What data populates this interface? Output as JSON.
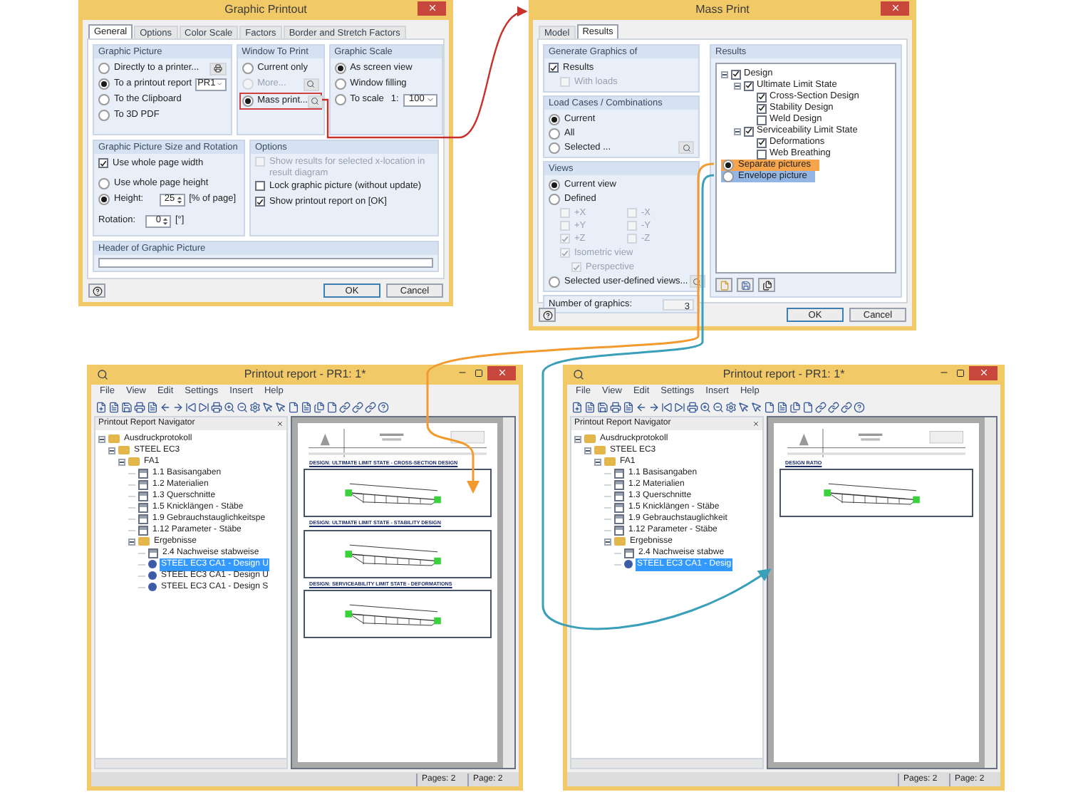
{
  "graphic_printout": {
    "title": "Graphic Printout",
    "tabs": [
      {
        "label": "General",
        "selected": true
      },
      {
        "label": "Options",
        "selected": false
      },
      {
        "label": "Color Scale",
        "selected": false
      },
      {
        "label": "Factors",
        "selected": false
      },
      {
        "label": "Border and Stretch Factors",
        "selected": false
      }
    ],
    "graphic_picture": {
      "title": "Graphic Picture",
      "options": [
        {
          "label": "Directly to a printer...",
          "selected": false
        },
        {
          "label": "To a printout report",
          "selected": true
        },
        {
          "label": "To the Clipboard",
          "selected": false
        },
        {
          "label": "To 3D PDF",
          "selected": false
        }
      ],
      "report": "PR1"
    },
    "window_to_print": {
      "title": "Window To Print",
      "options": [
        {
          "label": "Current only",
          "selected": false,
          "disabled": false,
          "highlighted": false
        },
        {
          "label": "More...",
          "selected": false,
          "disabled": true,
          "highlighted": false
        },
        {
          "label": "Mass print...",
          "selected": true,
          "disabled": false,
          "highlighted": true
        }
      ]
    },
    "graphic_scale": {
      "title": "Graphic Scale",
      "options": [
        {
          "label": "As screen view",
          "selected": true
        },
        {
          "label": "Window filling",
          "selected": false
        },
        {
          "label": "To scale",
          "selected": false
        }
      ],
      "scale_prefix": "1:",
      "scale": "100"
    },
    "size_rotation": {
      "title": "Graphic Picture Size and Rotation",
      "whole_width": {
        "label": "Use whole page width",
        "checked": true
      },
      "size_options": [
        {
          "label": "Use whole page height",
          "selected": false
        },
        {
          "label": "Height:",
          "selected": true
        }
      ],
      "height": {
        "value": "25",
        "unit": "[% of page]"
      },
      "rotation": {
        "label": "Rotation:",
        "value": "0",
        "unit": "[°]"
      }
    },
    "options": {
      "title": "Options",
      "items": [
        {
          "label": "Show results for selected x-location in result diagram",
          "checked": false,
          "disabled": true
        },
        {
          "label": "Lock graphic picture (without update)",
          "checked": false,
          "disabled": false
        },
        {
          "label": "Show printout report on [OK]",
          "checked": true,
          "disabled": false
        }
      ]
    },
    "header": {
      "title": "Header of Graphic Picture"
    },
    "buttons": [
      "OK",
      "Cancel"
    ]
  },
  "mass_print": {
    "title": "Mass Print",
    "tabs": [
      {
        "label": "Model",
        "selected": false
      },
      {
        "label": "Results",
        "selected": true
      }
    ],
    "generate": {
      "title": "Generate Graphics of",
      "items": [
        {
          "label": "Results",
          "checked": true,
          "disabled": false
        },
        {
          "label": "With loads",
          "checked": false,
          "disabled": true
        }
      ]
    },
    "load_cases": {
      "title": "Load Cases / Combinations",
      "options": [
        {
          "label": "Current",
          "selected": true
        },
        {
          "label": "All",
          "selected": false
        },
        {
          "label": "Selected ...",
          "selected": false
        }
      ]
    },
    "views": {
      "title": "Views",
      "options": [
        {
          "label": "Current view",
          "selected": true
        },
        {
          "label": "Defined",
          "selected": false
        }
      ],
      "directions": [
        {
          "label": "+X",
          "checked": false
        },
        {
          "label": "-X",
          "checked": false
        },
        {
          "label": "+Y",
          "checked": false
        },
        {
          "label": "-Y",
          "checked": false
        },
        {
          "label": "+Z",
          "checked": true
        },
        {
          "label": "-Z",
          "checked": false
        }
      ],
      "isometric": {
        "label": "Isometric view",
        "checked": true
      },
      "perspective": {
        "label": "Perspective",
        "checked": true
      },
      "user_defined": {
        "label": "Selected user-defined views...",
        "selected": false
      }
    },
    "number_of_graphics": {
      "label": "Number of graphics:",
      "value": "3"
    },
    "results": {
      "title": "Results",
      "tree": [
        {
          "label": "Design",
          "checked": true,
          "children": [
            {
              "label": "Ultimate Limit State",
              "checked": true,
              "children": [
                {
                  "label": "Cross-Section Design",
                  "checked": true
                },
                {
                  "label": "Stability Design",
                  "checked": true
                },
                {
                  "label": "Weld Design",
                  "checked": false
                }
              ]
            },
            {
              "label": "Serviceability Limit State",
              "checked": true,
              "children": [
                {
                  "label": "Deformations",
                  "checked": true
                },
                {
                  "label": "Web Breathing",
                  "checked": false
                }
              ]
            }
          ]
        }
      ],
      "picture_modes": [
        {
          "label": "Separate pictures",
          "selected": true,
          "color": "#f7a54c"
        },
        {
          "label": "Envelope picture",
          "selected": false,
          "color": "#93b6e4"
        }
      ]
    },
    "buttons": [
      "OK",
      "Cancel"
    ]
  },
  "reports": [
    {
      "title": "Printout report - PR1: 1*",
      "menu": [
        "File",
        "View",
        "Edit",
        "Settings",
        "Insert",
        "Help"
      ],
      "navigator_title": "Printout Report Navigator",
      "tree": [
        {
          "label": "Ausdruckprotokoll",
          "kind": "folder",
          "selected": false,
          "children": [
            {
              "label": "STEEL EC3",
              "kind": "folder",
              "selected": false,
              "children": [
                {
                  "label": "FA1",
                  "kind": "folder",
                  "selected": false,
                  "children": [
                    {
                      "label": "1.1 Basisangaben",
                      "kind": "table",
                      "selected": false
                    },
                    {
                      "label": "1.2 Materialien",
                      "kind": "table",
                      "selected": false
                    },
                    {
                      "label": "1.3 Querschnitte",
                      "kind": "table",
                      "selected": false
                    },
                    {
                      "label": "1.5 Knicklängen - Stäbe",
                      "kind": "table",
                      "selected": false
                    },
                    {
                      "label": "1.9 Gebrauchstauglichkeitspe",
                      "kind": "table",
                      "selected": false
                    },
                    {
                      "label": "1.12 Parameter - Stäbe",
                      "kind": "table",
                      "selected": false
                    },
                    {
                      "label": "Ergebnisse",
                      "kind": "folder",
                      "selected": false,
                      "children": [
                        {
                          "label": "2.4 Nachweise stabweise",
                          "kind": "table",
                          "selected": false
                        },
                        {
                          "label": "STEEL EC3 CA1 - Design U",
                          "kind": "graphic",
                          "selected": true
                        },
                        {
                          "label": "STEEL EC3 CA1 - Design U",
                          "kind": "graphic",
                          "selected": false
                        },
                        {
                          "label": "STEEL EC3 CA1 - Design S",
                          "kind": "graphic",
                          "selected": false
                        }
                      ]
                    }
                  ]
                }
              ]
            }
          ]
        }
      ],
      "sections": [
        "DESIGN: ULTIMATE LIMIT STATE - CROSS-SECTION DESIGN",
        "DESIGN: ULTIMATE LIMIT STATE - STABILITY DESIGN",
        "DESIGN: SERVICEABILITY LIMIT STATE - DEFORMATIONS"
      ],
      "status": [
        "Pages: 2",
        "Page: 2"
      ]
    },
    {
      "title": "Printout report - PR1: 1*",
      "menu": [
        "File",
        "View",
        "Edit",
        "Settings",
        "Insert",
        "Help"
      ],
      "navigator_title": "Printout Report Navigator",
      "tree": [
        {
          "label": "Ausdruckprotokoll",
          "kind": "folder",
          "selected": false,
          "children": [
            {
              "label": "STEEL EC3",
              "kind": "folder",
              "selected": false,
              "children": [
                {
                  "label": "FA1",
                  "kind": "folder",
                  "selected": false,
                  "children": [
                    {
                      "label": "1.1 Basisangaben",
                      "kind": "table",
                      "selected": false
                    },
                    {
                      "label": "1.2 Materialien",
                      "kind": "table",
                      "selected": false
                    },
                    {
                      "label": "1.3 Querschnitte",
                      "kind": "table",
                      "selected": false
                    },
                    {
                      "label": "1.5 Knicklängen - Stäbe",
                      "kind": "table",
                      "selected": false
                    },
                    {
                      "label": "1.9 Gebrauchstauglichkeit",
                      "kind": "table",
                      "selected": false
                    },
                    {
                      "label": "1.12 Parameter - Stäbe",
                      "kind": "table",
                      "selected": false
                    },
                    {
                      "label": "Ergebnisse",
                      "kind": "folder",
                      "selected": false,
                      "children": [
                        {
                          "label": "2.4 Nachweise stabwe",
                          "kind": "table",
                          "selected": false
                        },
                        {
                          "label": "STEEL EC3 CA1 - Desig",
                          "kind": "graphic",
                          "selected": true
                        }
                      ]
                    }
                  ]
                }
              ]
            }
          ]
        }
      ],
      "sections": [
        "DESIGN RATIO"
      ],
      "status": [
        "Pages: 2",
        "Page: 2"
      ]
    }
  ]
}
